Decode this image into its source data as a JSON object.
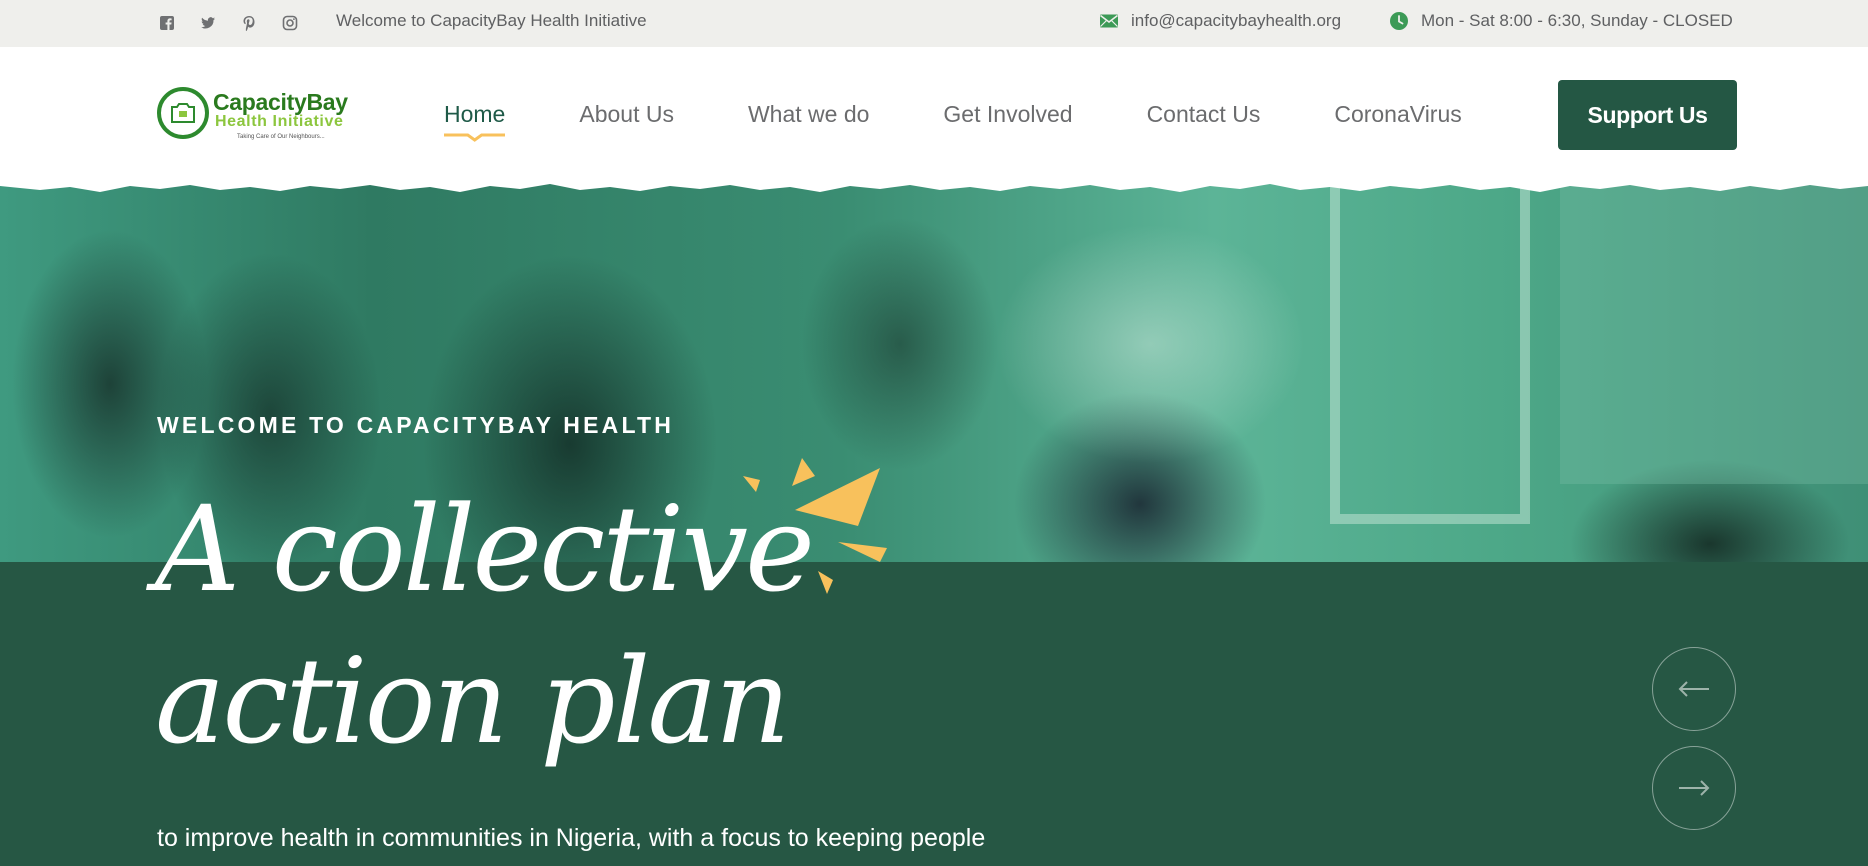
{
  "topbar": {
    "social": [
      {
        "icon": "facebook-icon"
      },
      {
        "icon": "twitter-icon"
      },
      {
        "icon": "pinterest-icon"
      },
      {
        "icon": "instagram-icon"
      }
    ],
    "welcome": "Welcome to CapacityBay Health Initiative",
    "email": "info@capacitybayhealth.org",
    "hours": "Mon - Sat 8:00 - 6:30, Sunday - CLOSED"
  },
  "header": {
    "logo": {
      "name": "CapacityBay",
      "subtitle": "Health Initiative",
      "tagline": "Taking Care of Our Neighbours..."
    },
    "nav": [
      {
        "label": "Home",
        "active": true
      },
      {
        "label": "About Us"
      },
      {
        "label": "What we do"
      },
      {
        "label": "Get Involved"
      },
      {
        "label": "Contact Us"
      },
      {
        "label": "CoronaVirus"
      }
    ],
    "support_label": "Support Us"
  },
  "hero": {
    "eyebrow": "WELCOME TO CAPACITYBAY HEALTH",
    "headline_line1": "A collective",
    "headline_line2": "action plan",
    "subtext": "to improve health in communities in Nigeria, with a focus to keeping people"
  },
  "colors": {
    "brand_dark_green": "#245744",
    "band_green": "#265744",
    "accent_yellow": "#f8c15c",
    "logo_green": "#2a7a1e",
    "logo_lime": "#8cc63e",
    "topbar_bg": "#efefec"
  }
}
